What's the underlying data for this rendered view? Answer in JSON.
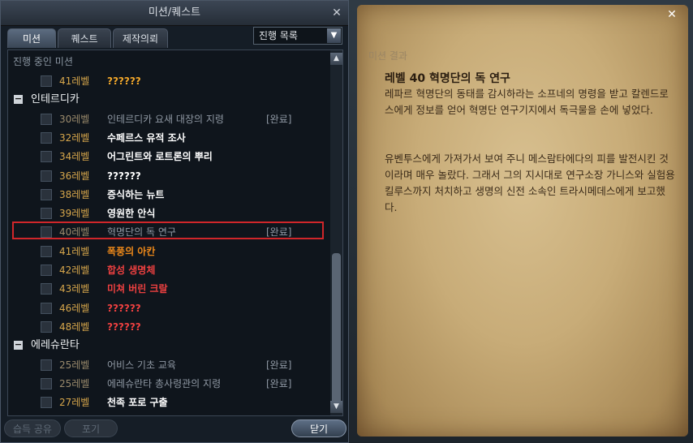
{
  "window": {
    "title": "미션/퀘스트",
    "close": "✕"
  },
  "tabs": [
    {
      "label": "미션"
    },
    {
      "label": "퀘스트"
    },
    {
      "label": "제작의뢰"
    }
  ],
  "filter": {
    "selected": "진행 목록",
    "arrow": "▼"
  },
  "list": {
    "section_label": "진행 중인 미션",
    "rows": [
      {
        "level": "41레벨",
        "name": "??????",
        "status": "",
        "name_color": "#f0a62a"
      },
      {
        "category": "인테르디카",
        "toggle": "−"
      },
      {
        "level": "30레벨",
        "name": "인테르디카 요새 대장의 지령",
        "status": "[완료]",
        "name_color": "#8f98a3"
      },
      {
        "level": "32레벨",
        "name": "수페르스 유적 조사",
        "status": "",
        "name_color": "#ffffff"
      },
      {
        "level": "34레벨",
        "name": "어그린트와 로트론의 뿌리",
        "status": "",
        "name_color": "#ffffff"
      },
      {
        "level": "36레벨",
        "name": "??????",
        "status": "",
        "name_color": "#ffffff"
      },
      {
        "level": "38레벨",
        "name": "증식하는 뉴트",
        "status": "",
        "name_color": "#ffffff"
      },
      {
        "level": "39레벨",
        "name": "영원한 안식",
        "status": "",
        "name_color": "#ffffff"
      },
      {
        "level": "40레벨",
        "name": "혁명단의 독 연구",
        "status": "[완료]",
        "name_color": "#8f98a3"
      },
      {
        "level": "41레벨",
        "name": "폭풍의 아칸",
        "status": "",
        "name_color": "#f08a1a"
      },
      {
        "level": "42레벨",
        "name": "합성 생명체",
        "status": "",
        "name_color": "#ee4040"
      },
      {
        "level": "43레벨",
        "name": "미쳐 버린 크랄",
        "status": "",
        "name_color": "#ee4040"
      },
      {
        "level": "46레벨",
        "name": "??????",
        "status": "",
        "name_color": "#ee4040"
      },
      {
        "level": "48레벨",
        "name": "??????",
        "status": "",
        "name_color": "#ee4040"
      },
      {
        "category": "에레슈란타",
        "toggle": "−"
      },
      {
        "level": "25레벨",
        "name": "어비스 기초 교육",
        "status": "[완료]",
        "name_color": "#8f98a3"
      },
      {
        "level": "25레벨",
        "name": "에레슈란타 총사령관의 지령",
        "status": "[완료]",
        "name_color": "#8f98a3"
      },
      {
        "level": "27레벨",
        "name": "천족 포로 구출",
        "status": "",
        "name_color": "#ffffff"
      }
    ]
  },
  "scroll": {
    "up": "▲",
    "down": "▼"
  },
  "buttons": {
    "share": "습득 공유",
    "abandon": "포기",
    "close": "닫기"
  },
  "detail": {
    "caption": "미션 결과",
    "title": "레벨 40 혁명단의 독 연구",
    "para1": "레파르 혁명단의 동태를 감시하라는 소프네의 명령을 받고 칼렌드로스에게 정보를 얻어 혁명단 연구기지에서 독극물을 손에 넣었다.",
    "para2": "유벤투스에게 가져가서 보여 주니 메스람타에다의 피를 발전시킨 것이라며 매우 놀랐다. 그래서 그의 지시대로 연구소장 가니스와 실험용 킬루스까지 처치하고 생명의 신전 소속인 트라시메데스에게 보고했다.",
    "close": "✕"
  }
}
